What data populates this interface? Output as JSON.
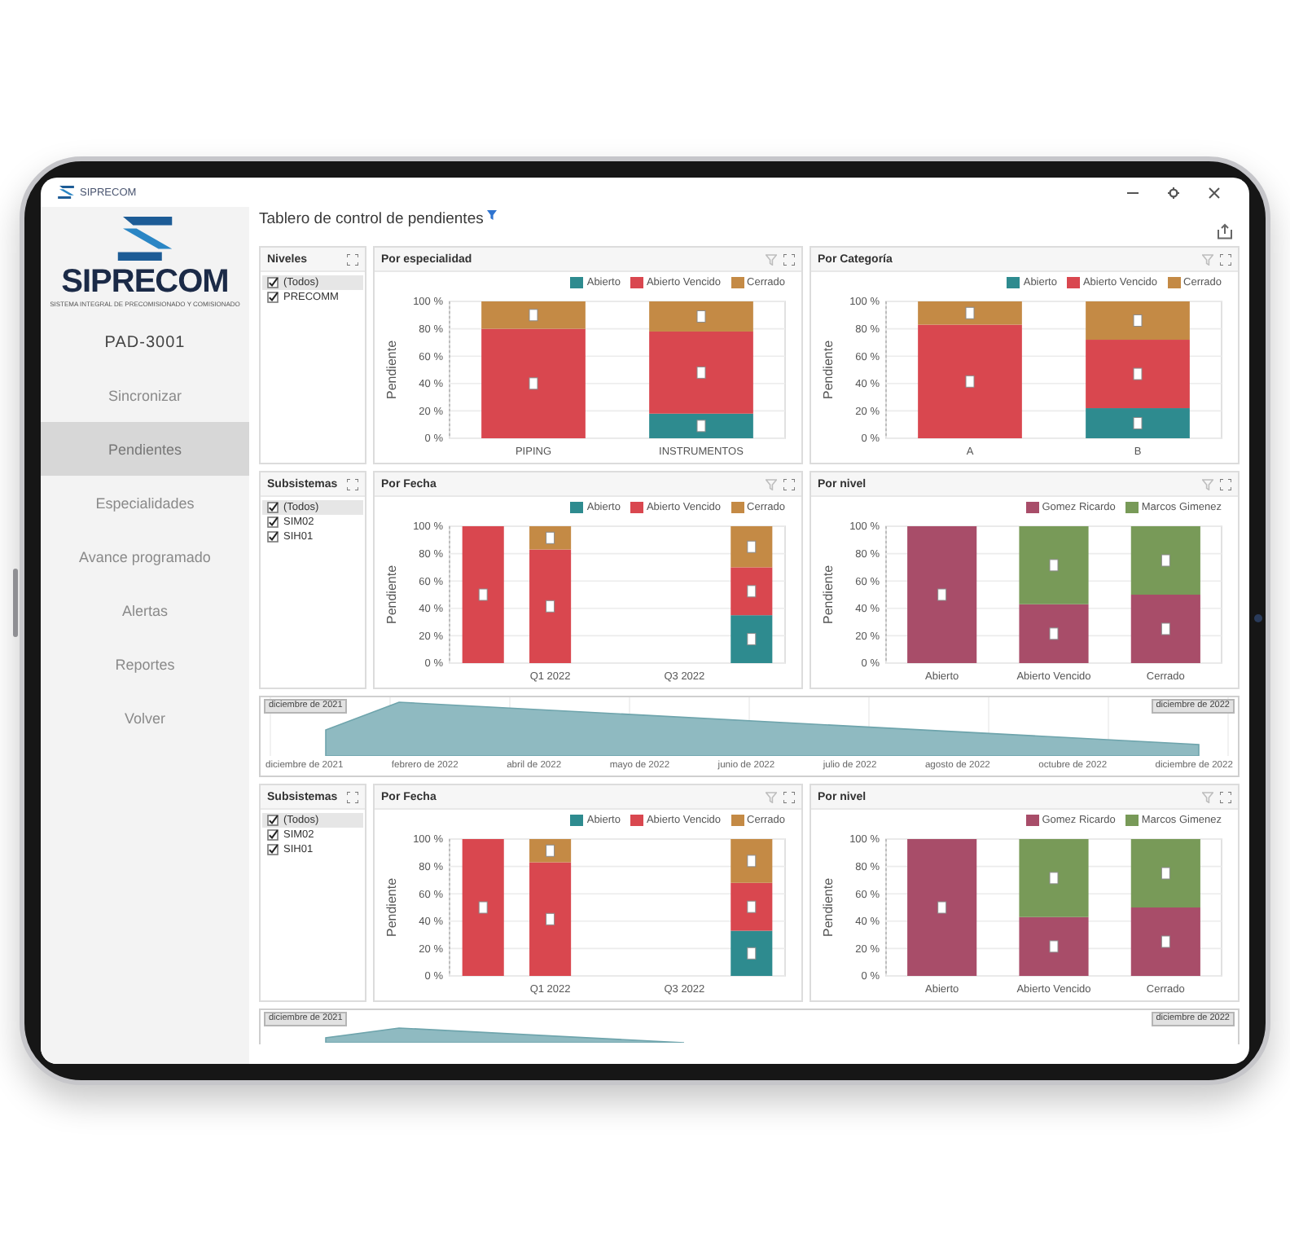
{
  "app": {
    "title": "SIPRECOM"
  },
  "sidebar": {
    "logo": "SIPRECOM",
    "tagline": "SISTEMA INTEGRAL DE PRECOMISIONADO Y COMISIONADO",
    "device": "PAD-3001",
    "items": [
      {
        "label": "Sincronizar",
        "selected": false
      },
      {
        "label": "Pendientes",
        "selected": true
      },
      {
        "label": "Especialidades",
        "selected": false
      },
      {
        "label": "Avance programado",
        "selected": false
      },
      {
        "label": "Alertas",
        "selected": false
      },
      {
        "label": "Reportes",
        "selected": false
      },
      {
        "label": "Volver",
        "selected": false
      }
    ]
  },
  "dashboard": {
    "title": "Tablero de control de pendientes",
    "sections": [
      {
        "filter": {
          "title": "Niveles",
          "items": [
            {
              "label": "(Todos)",
              "checked": true,
              "selected": true
            },
            {
              "label": "PRECOMM",
              "checked": true,
              "selected": false
            }
          ]
        },
        "charts": [
          {
            "title": "Por especialidad",
            "chart_data": {
              "type": "bar",
              "ylabel": "Pendiente",
              "categories": [
                "PIPING",
                "INSTRUMENTOS"
              ],
              "series": [
                {
                  "name": "Abierto",
                  "color": "#2e8b8f",
                  "values": [
                    0,
                    18
                  ]
                },
                {
                  "name": "Abierto Vencido",
                  "color": "#d9474f",
                  "values": [
                    80,
                    60
                  ]
                },
                {
                  "name": "Cerrado",
                  "color": "#c48a45",
                  "values": [
                    20,
                    22
                  ]
                }
              ],
              "stacked": true,
              "grid": true,
              "ylim": [
                0,
                100
              ],
              "yticks": [
                {
                  "value": 0,
                  "label": "0 %"
                },
                {
                  "value": 20,
                  "label": "20 %"
                },
                {
                  "value": 40,
                  "label": "40 %"
                },
                {
                  "value": 60,
                  "label": "60 %"
                },
                {
                  "value": 80,
                  "label": "80 %"
                },
                {
                  "value": 100,
                  "label": "100 %"
                }
              ]
            }
          },
          {
            "title": "Por Categoría",
            "chart_data": {
              "type": "bar",
              "ylabel": "Pendiente",
              "categories": [
                "A",
                "B"
              ],
              "series": [
                {
                  "name": "Abierto",
                  "color": "#2e8b8f",
                  "values": [
                    0,
                    22
                  ]
                },
                {
                  "name": "Abierto Vencido",
                  "color": "#d9474f",
                  "values": [
                    83,
                    50
                  ]
                },
                {
                  "name": "Cerrado",
                  "color": "#c48a45",
                  "values": [
                    17,
                    28
                  ]
                }
              ],
              "stacked": true,
              "grid": true,
              "ylim": [
                0,
                100
              ],
              "yticks": [
                {
                  "value": 0,
                  "label": "0 %"
                },
                {
                  "value": 20,
                  "label": "20 %"
                },
                {
                  "value": 40,
                  "label": "40 %"
                },
                {
                  "value": 60,
                  "label": "60 %"
                },
                {
                  "value": 80,
                  "label": "80 %"
                },
                {
                  "value": 100,
                  "label": "100 %"
                }
              ]
            }
          }
        ]
      },
      {
        "filter": {
          "title": "Subsistemas",
          "items": [
            {
              "label": "(Todos)",
              "checked": true,
              "selected": true
            },
            {
              "label": "SIM02",
              "checked": true,
              "selected": false
            },
            {
              "label": "SIH01",
              "checked": true,
              "selected": false
            }
          ]
        },
        "charts": [
          {
            "title": "Por Fecha",
            "chart_data": {
              "type": "bar",
              "ylabel": "Pendiente",
              "categories": [
                null,
                "Q1 2022",
                null,
                "Q3 2022",
                null
              ],
              "series": [
                {
                  "name": "Abierto",
                  "color": "#2e8b8f",
                  "values": [
                    0,
                    0,
                    null,
                    null,
                    35
                  ]
                },
                {
                  "name": "Abierto Vencido",
                  "color": "#d9474f",
                  "values": [
                    100,
                    83,
                    null,
                    null,
                    35
                  ]
                },
                {
                  "name": "Cerrado",
                  "color": "#c48a45",
                  "values": [
                    0,
                    17,
                    null,
                    null,
                    30
                  ]
                }
              ],
              "stacked": true,
              "grid": true,
              "ylim": [
                0,
                100
              ],
              "yticks": [
                {
                  "value": 0,
                  "label": "0 %"
                },
                {
                  "value": 20,
                  "label": "20 %"
                },
                {
                  "value": 40,
                  "label": "40 %"
                },
                {
                  "value": 60,
                  "label": "60 %"
                },
                {
                  "value": 80,
                  "label": "80 %"
                },
                {
                  "value": 100,
                  "label": "100 %"
                }
              ]
            }
          },
          {
            "title": "Por nivel",
            "chart_data": {
              "type": "bar",
              "ylabel": "Pendiente",
              "categories": [
                "Abierto",
                "Abierto Vencido",
                "Cerrado"
              ],
              "series": [
                {
                  "name": "Gomez Ricardo",
                  "color": "#a84d69",
                  "values": [
                    100,
                    43,
                    50
                  ]
                },
                {
                  "name": "Marcos Gimenez",
                  "color": "#789a58",
                  "values": [
                    0,
                    57,
                    50
                  ]
                }
              ],
              "stacked": true,
              "grid": true,
              "ylim": [
                0,
                100
              ],
              "yticks": [
                {
                  "value": 0,
                  "label": "0 %"
                },
                {
                  "value": 20,
                  "label": "20 %"
                },
                {
                  "value": 40,
                  "label": "40 %"
                },
                {
                  "value": 60,
                  "label": "60 %"
                },
                {
                  "value": 80,
                  "label": "80 %"
                },
                {
                  "value": 100,
                  "label": "100 %"
                }
              ]
            }
          }
        ],
        "timeline": {
          "start_tag": "diciembre de 2021",
          "end_tag": "diciembre de 2022",
          "axis_labels": [
            "diciembre de 2021",
            "febrero de 2022",
            "abril de 2022",
            "mayo de 2022",
            "junio de 2022",
            "julio de 2022",
            "agosto de 2022",
            "octubre de 2022",
            "diciembre de 2022"
          ]
        }
      },
      {
        "filter": {
          "title": "Subsistemas",
          "items": [
            {
              "label": "(Todos)",
              "checked": true,
              "selected": true
            },
            {
              "label": "SIM02",
              "checked": true,
              "selected": false
            },
            {
              "label": "SIH01",
              "checked": true,
              "selected": false
            }
          ]
        },
        "charts": [
          {
            "title": "Por Fecha",
            "chart_data": {
              "type": "bar",
              "ylabel": "Pendiente",
              "categories": [
                null,
                "Q1 2022",
                null,
                "Q3 2022",
                null
              ],
              "series": [
                {
                  "name": "Abierto",
                  "color": "#2e8b8f",
                  "values": [
                    0,
                    0,
                    null,
                    null,
                    33
                  ]
                },
                {
                  "name": "Abierto Vencido",
                  "color": "#d9474f",
                  "values": [
                    100,
                    83,
                    null,
                    null,
                    35
                  ]
                },
                {
                  "name": "Cerrado",
                  "color": "#c48a45",
                  "values": [
                    0,
                    17,
                    null,
                    null,
                    32
                  ]
                }
              ],
              "stacked": true,
              "grid": true,
              "ylim": [
                0,
                100
              ],
              "yticks": [
                {
                  "value": 0,
                  "label": "0 %"
                },
                {
                  "value": 20,
                  "label": "20 %"
                },
                {
                  "value": 40,
                  "label": "40 %"
                },
                {
                  "value": 60,
                  "label": "60 %"
                },
                {
                  "value": 80,
                  "label": "80 %"
                },
                {
                  "value": 100,
                  "label": "100 %"
                }
              ]
            }
          },
          {
            "title": "Por nivel",
            "chart_data": {
              "type": "bar",
              "ylabel": "Pendiente",
              "categories": [
                "Abierto",
                "Abierto Vencido",
                "Cerrado"
              ],
              "series": [
                {
                  "name": "Gomez Ricardo",
                  "color": "#a84d69",
                  "values": [
                    100,
                    43,
                    50
                  ]
                },
                {
                  "name": "Marcos Gimenez",
                  "color": "#789a58",
                  "values": [
                    0,
                    57,
                    50
                  ]
                }
              ],
              "stacked": true,
              "grid": true,
              "ylim": [
                0,
                100
              ],
              "yticks": [
                {
                  "value": 0,
                  "label": "0 %"
                },
                {
                  "value": 20,
                  "label": "20 %"
                },
                {
                  "value": 40,
                  "label": "40 %"
                },
                {
                  "value": 60,
                  "label": "60 %"
                },
                {
                  "value": 80,
                  "label": "80 %"
                },
                {
                  "value": 100,
                  "label": "100 %"
                }
              ]
            }
          }
        ],
        "timeline": {
          "start_tag": "diciembre de 2021",
          "end_tag": "diciembre de 2022"
        }
      }
    ]
  }
}
